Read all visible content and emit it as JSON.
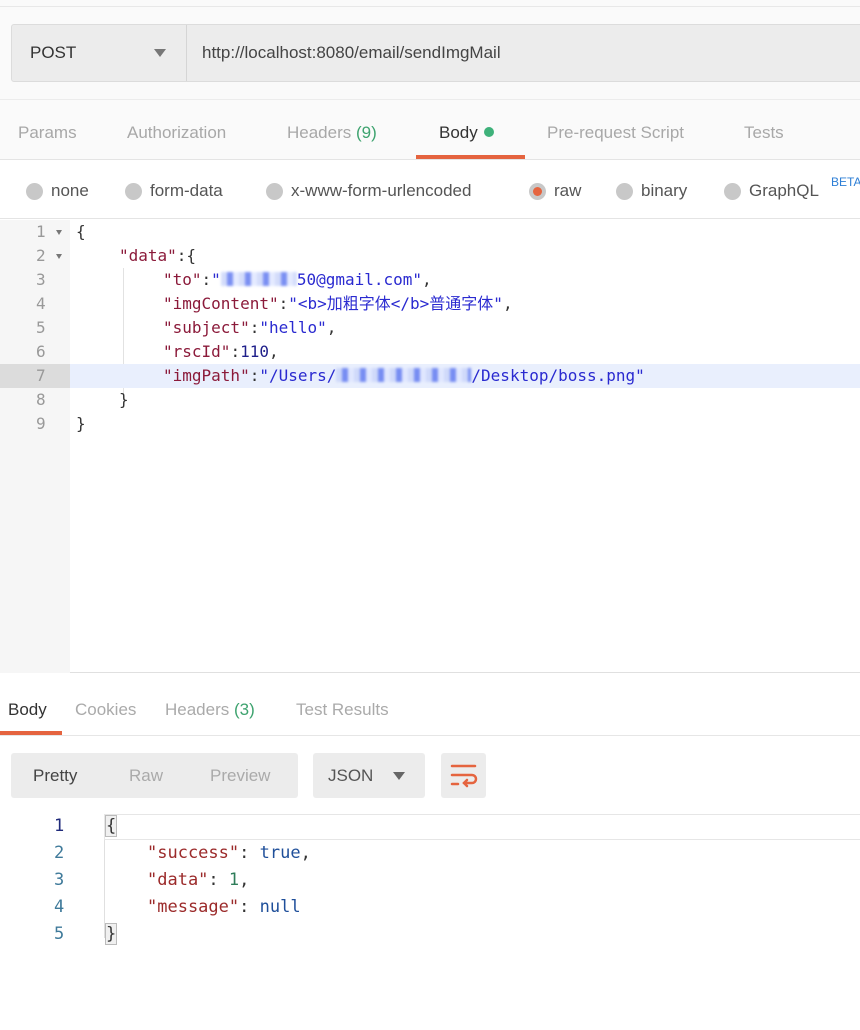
{
  "request": {
    "method": "POST",
    "url": "http://localhost:8080/email/sendImgMail"
  },
  "request_tabs": [
    {
      "label": "Params"
    },
    {
      "label": "Authorization"
    },
    {
      "label": "Headers",
      "count": "(9)"
    },
    {
      "label": "Body",
      "active": true
    },
    {
      "label": "Pre-request Script"
    },
    {
      "label": "Tests"
    }
  ],
  "body_types": [
    {
      "label": "none"
    },
    {
      "label": "form-data"
    },
    {
      "label": "x-www-form-urlencoded"
    },
    {
      "label": "raw",
      "selected": true
    },
    {
      "label": "binary"
    },
    {
      "label": "GraphQL",
      "badge": "BETA"
    }
  ],
  "request_body": {
    "line_numbers": [
      "1",
      "2",
      "3",
      "4",
      "5",
      "6",
      "7",
      "8",
      "9"
    ],
    "open_brace": "{",
    "data_key": "\"data\"",
    "to_key": "\"to\"",
    "to_prefix": "\"",
    "to_value_visible": "50@gmail.com\"",
    "img_content_key": "\"imgContent\"",
    "img_content_value": "\"<b>加粗字体</b>普通字体\"",
    "subject_key": "\"subject\"",
    "subject_value": "\"hello\"",
    "rsc_id_key": "\"rscId\"",
    "rsc_id_value": "110",
    "img_path_key": "\"imgPath\"",
    "img_path_prefix": "\"/Users/",
    "img_path_suffix": "/Desktop/boss.png\"",
    "close_inner": "}",
    "close_outer": "}"
  },
  "response_tabs": [
    {
      "label": "Body",
      "active": true
    },
    {
      "label": "Cookies"
    },
    {
      "label": "Headers",
      "count": "(3)"
    },
    {
      "label": "Test Results"
    }
  ],
  "response_view": {
    "modes": [
      "Pretty",
      "Raw",
      "Preview"
    ],
    "format": "JSON",
    "wrap_icon": "wrap-lines-icon"
  },
  "response_body": {
    "line_numbers": [
      "1",
      "2",
      "3",
      "4",
      "5"
    ],
    "success_key": "\"success\"",
    "success_value": "true",
    "data_key": "\"data\"",
    "data_value": "1",
    "message_key": "\"message\"",
    "message_value": "null"
  },
  "colors": {
    "accent": "#e5643f",
    "green": "#3eb17a"
  }
}
